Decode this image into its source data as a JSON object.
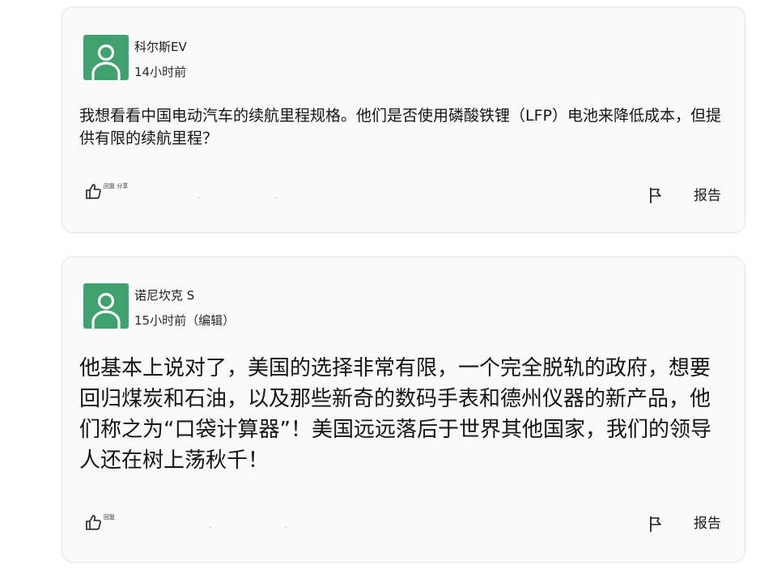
{
  "posts": [
    {
      "username": "科尔斯EV",
      "timestamp": "14小时前",
      "body": "我想看看中国电动汽车的续航里程规格。他们是否使用磷酸铁锂（LFP）电池来降低成本，但提供有限的续航里程？",
      "actions": {
        "reply_share": "回复 分享",
        "report": "报告"
      }
    },
    {
      "username": "诺尼坎克 S",
      "timestamp": "15小时前（编辑）",
      "body": "他基本上说对了，美国的选择非常有限，一个完全脱轨的政府，想要回归煤炭和石油，以及那些新奇的数码手表和德州仪器的新产品，他们称之为“口袋计算器”！美国远远落后于世界其他国家，我们的领导人还在树上荡秋千！",
      "actions": {
        "reply_share": "回复",
        "report": "报告"
      }
    }
  ],
  "icons": {
    "avatar": "default-user-avatar-icon",
    "like": "thumbs-up-icon",
    "report": "flag-icon"
  },
  "colors": {
    "avatar_bg": "#3fa26e",
    "card_bg": "#fafafa",
    "card_border": "#e3e3e3"
  }
}
